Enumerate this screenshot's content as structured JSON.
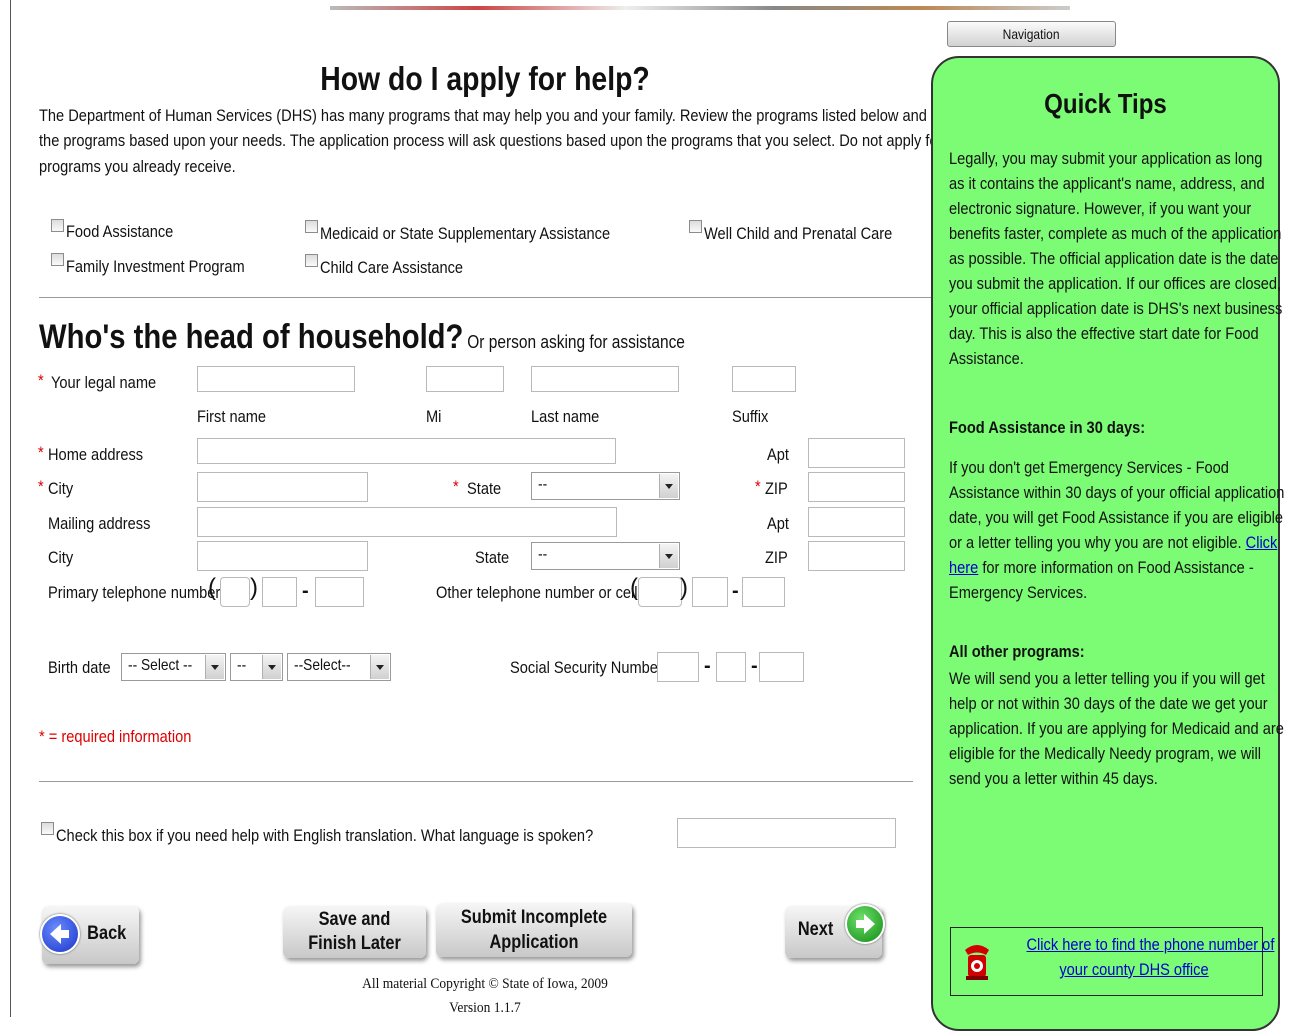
{
  "nav_label": "Navigation",
  "main": {
    "title": "How do I apply for help?",
    "intro": [
      "The Department of Human Services (DHS) has many programs that may help you and your family. Review the programs listed below and select",
      "the programs based upon your needs. The application process will ask questions based upon the programs that you select. Do not apply for",
      "programs you already receive."
    ],
    "programs": [
      "Food Assistance",
      "Family Investment Program",
      "Medicaid or State Supplementary Assistance",
      "Child Care Assistance",
      "Well Child and Prenatal Care"
    ],
    "household_title": "Who's the head of household?",
    "household_subtitle": "Or person asking for assistance",
    "asterisk": "*",
    "labels": {
      "legal_name": "Your legal name",
      "first_name": "First name",
      "mi": "Mi",
      "last_name": "Last name",
      "suffix": "Suffix",
      "home_address": "Home address",
      "apt": "Apt",
      "city": "City",
      "state": "State",
      "zip": "ZIP",
      "mailing_address": "Mailing address",
      "primary_phone": "Primary telephone number",
      "other_phone": "Other telephone number or cell",
      "birth_date": "Birth date",
      "ssn": "Social Security Number"
    },
    "selects": {
      "state": "--",
      "mailing_state": "--",
      "birth_month": "-- Select --",
      "birth_day": "--",
      "birth_year": "--Select--"
    },
    "phone_punct": {
      "open": "(",
      "close": ")",
      "dash": "-"
    },
    "required_note": "* = required information",
    "translation": "Check this box if you need help with English translation. What language is spoken?",
    "buttons": {
      "back": "Back",
      "save_1": "Save and",
      "save_2": "Finish Later",
      "submit_1": "Submit Incomplete",
      "submit_2": "Application",
      "next": "Next"
    },
    "footer_1": "All material Copyright © State of Iowa, 2009",
    "footer_2": "Version 1.1.7"
  },
  "tips": {
    "title": "Quick Tips",
    "para1": [
      "Legally, you may submit your application as long",
      "as it contains the applicant's name, address, and",
      "electronic signature. However, if you want your",
      "benefits faster, complete as much of the application",
      "as possible. The official application date is the date",
      "you submit the application. If our offices are closed,",
      "your official application date is DHS's next business",
      "day. This is also the effective start date for Food",
      "Assistance."
    ],
    "food_heading": "Food Assistance in 30 days:",
    "para2": [
      "If you don't get Emergency Services - Food",
      "Assistance within 30 days of your official application",
      "date, you will get Food Assistance if you are eligible"
    ],
    "para2_line4_pre": "or a letter telling you why you are not eligible. ",
    "para2_link1": "Click",
    "para2_link2": "here",
    "para2_line5_post": " for more information on Food Assistance -",
    "para2_line6": "Emergency Services.",
    "other_heading": "All other programs:",
    "para3": [
      "We will send you a letter telling you if you will get",
      "help or not within 30 days of the date we get your",
      "application. If you are applying for Medicaid and are",
      "eligible for the Medically Needy program, we will",
      "send you a letter within 45 days."
    ],
    "phone_link_1": "Click here to find the phone number of",
    "phone_link_2": "your county DHS office"
  },
  "colors": {
    "tips_bg": "#7cfc75",
    "required": "#dd0000",
    "link": "#0000cc"
  }
}
